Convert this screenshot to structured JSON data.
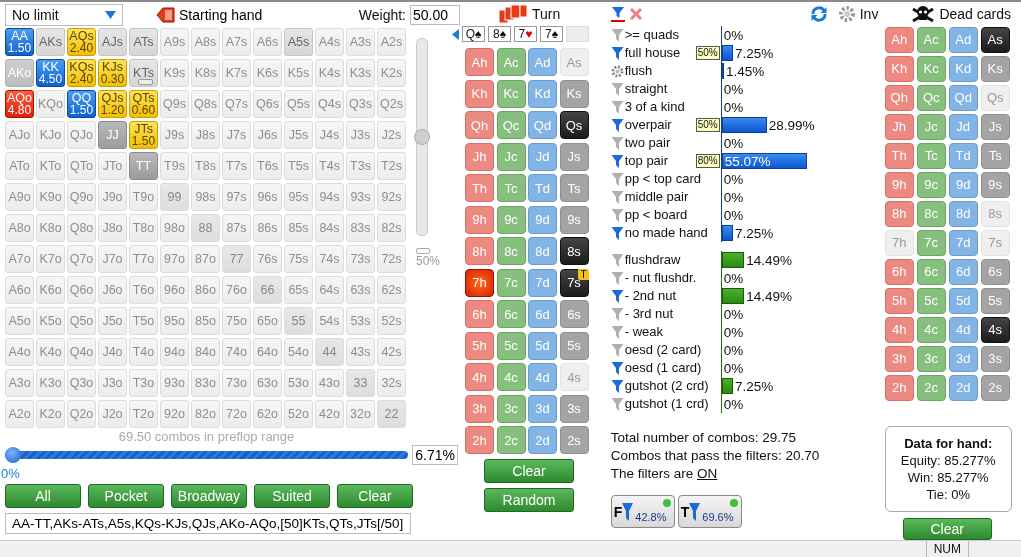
{
  "range_panel": {
    "game_type": "No limit",
    "starting_hand_label": "Starting hand",
    "weight_label": "Weight:",
    "weight_value": "50.00",
    "weight_slider": {
      "level": 0.5,
      "label": "50%"
    },
    "matrix": [
      [
        {
          "label": "AA",
          "kind": "blue",
          "weight": "1.50"
        },
        {
          "label": "AKs",
          "kind": "grey"
        },
        {
          "label": "AQs",
          "kind": "yellow",
          "weight": "2.40"
        },
        {
          "label": "AJs",
          "kind": "grey"
        },
        {
          "label": "ATs",
          "kind": "grey"
        },
        {
          "label": "A9s",
          "kind": "off"
        },
        {
          "label": "A8s",
          "kind": "off"
        },
        {
          "label": "A7s",
          "kind": "off"
        },
        {
          "label": "A6s",
          "kind": "off"
        },
        {
          "label": "A5s",
          "kind": "grey"
        },
        {
          "label": "A4s",
          "kind": "off"
        },
        {
          "label": "A3s",
          "kind": "off"
        },
        {
          "label": "A2s",
          "kind": "off"
        }
      ],
      [
        {
          "label": "AKo",
          "kind": "medium"
        },
        {
          "label": "KK",
          "kind": "blue",
          "weight": "4.50"
        },
        {
          "label": "KQs",
          "kind": "yellow",
          "weight": "2.40"
        },
        {
          "label": "KJs",
          "kind": "yellow",
          "weight": "0.30"
        },
        {
          "label": "KTs",
          "kind": "grey",
          "bar": true
        },
        {
          "label": "K9s",
          "kind": "off"
        },
        {
          "label": "K8s",
          "kind": "off"
        },
        {
          "label": "K7s",
          "kind": "off"
        },
        {
          "label": "K6s",
          "kind": "off"
        },
        {
          "label": "K5s",
          "kind": "off"
        },
        {
          "label": "K4s",
          "kind": "off"
        },
        {
          "label": "K3s",
          "kind": "off"
        },
        {
          "label": "K2s",
          "kind": "off"
        }
      ],
      [
        {
          "label": "AQo",
          "kind": "red",
          "weight": "4.80"
        },
        {
          "label": "KQo",
          "kind": "off"
        },
        {
          "label": "QQ",
          "kind": "blue",
          "weight": "1.50"
        },
        {
          "label": "QJs",
          "kind": "yellow",
          "weight": "1.20"
        },
        {
          "label": "QTs",
          "kind": "yellow",
          "weight": "0.60"
        },
        {
          "label": "Q9s",
          "kind": "off"
        },
        {
          "label": "Q8s",
          "kind": "off"
        },
        {
          "label": "Q7s",
          "kind": "off"
        },
        {
          "label": "Q6s",
          "kind": "off"
        },
        {
          "label": "Q5s",
          "kind": "off"
        },
        {
          "label": "Q4s",
          "kind": "off"
        },
        {
          "label": "Q3s",
          "kind": "off"
        },
        {
          "label": "Q2s",
          "kind": "off"
        }
      ],
      [
        {
          "label": "AJo",
          "kind": "off"
        },
        {
          "label": "KJo",
          "kind": "off"
        },
        {
          "label": "QJo",
          "kind": "off"
        },
        {
          "label": "JJ",
          "kind": "dark"
        },
        {
          "label": "JTs",
          "kind": "yellow",
          "weight": "1.50"
        },
        {
          "label": "J9s",
          "kind": "off"
        },
        {
          "label": "J8s",
          "kind": "off"
        },
        {
          "label": "J7s",
          "kind": "off"
        },
        {
          "label": "J6s",
          "kind": "off"
        },
        {
          "label": "J5s",
          "kind": "off"
        },
        {
          "label": "J4s",
          "kind": "off"
        },
        {
          "label": "J3s",
          "kind": "off"
        },
        {
          "label": "J2s",
          "kind": "off"
        }
      ],
      [
        {
          "label": "ATo",
          "kind": "off"
        },
        {
          "label": "KTo",
          "kind": "off"
        },
        {
          "label": "QTo",
          "kind": "off"
        },
        {
          "label": "JTo",
          "kind": "off"
        },
        {
          "label": "TT",
          "kind": "dark"
        },
        {
          "label": "T9s",
          "kind": "off"
        },
        {
          "label": "T8s",
          "kind": "off"
        },
        {
          "label": "T7s",
          "kind": "off"
        },
        {
          "label": "T6s",
          "kind": "off"
        },
        {
          "label": "T5s",
          "kind": "off"
        },
        {
          "label": "T4s",
          "kind": "off"
        },
        {
          "label": "T3s",
          "kind": "off"
        },
        {
          "label": "T2s",
          "kind": "off"
        }
      ],
      [
        {
          "label": "A9o",
          "kind": "off"
        },
        {
          "label": "K9o",
          "kind": "off"
        },
        {
          "label": "Q9o",
          "kind": "off"
        },
        {
          "label": "J9o",
          "kind": "off"
        },
        {
          "label": "T9o",
          "kind": "off"
        },
        {
          "label": "99",
          "kind": "pair"
        },
        {
          "label": "98s",
          "kind": "off"
        },
        {
          "label": "97s",
          "kind": "off"
        },
        {
          "label": "96s",
          "kind": "off"
        },
        {
          "label": "95s",
          "kind": "off"
        },
        {
          "label": "94s",
          "kind": "off"
        },
        {
          "label": "93s",
          "kind": "off"
        },
        {
          "label": "92s",
          "kind": "off"
        }
      ],
      [
        {
          "label": "A8o",
          "kind": "off"
        },
        {
          "label": "K8o",
          "kind": "off"
        },
        {
          "label": "Q8o",
          "kind": "off"
        },
        {
          "label": "J8o",
          "kind": "off"
        },
        {
          "label": "T8o",
          "kind": "off"
        },
        {
          "label": "98o",
          "kind": "off"
        },
        {
          "label": "88",
          "kind": "pair"
        },
        {
          "label": "87s",
          "kind": "off"
        },
        {
          "label": "86s",
          "kind": "off"
        },
        {
          "label": "85s",
          "kind": "off"
        },
        {
          "label": "84s",
          "kind": "off"
        },
        {
          "label": "83s",
          "kind": "off"
        },
        {
          "label": "82s",
          "kind": "off"
        }
      ],
      [
        {
          "label": "A7o",
          "kind": "off"
        },
        {
          "label": "K7o",
          "kind": "off"
        },
        {
          "label": "Q7o",
          "kind": "off"
        },
        {
          "label": "J7o",
          "kind": "off"
        },
        {
          "label": "T7o",
          "kind": "off"
        },
        {
          "label": "97o",
          "kind": "off"
        },
        {
          "label": "87o",
          "kind": "off"
        },
        {
          "label": "77",
          "kind": "pair"
        },
        {
          "label": "76s",
          "kind": "off"
        },
        {
          "label": "75s",
          "kind": "off"
        },
        {
          "label": "74s",
          "kind": "off"
        },
        {
          "label": "73s",
          "kind": "off"
        },
        {
          "label": "72s",
          "kind": "off"
        }
      ],
      [
        {
          "label": "A6o",
          "kind": "off"
        },
        {
          "label": "K6o",
          "kind": "off"
        },
        {
          "label": "Q6o",
          "kind": "off"
        },
        {
          "label": "J6o",
          "kind": "off"
        },
        {
          "label": "T6o",
          "kind": "off"
        },
        {
          "label": "96o",
          "kind": "off"
        },
        {
          "label": "86o",
          "kind": "off"
        },
        {
          "label": "76o",
          "kind": "off"
        },
        {
          "label": "66",
          "kind": "pair"
        },
        {
          "label": "65s",
          "kind": "off"
        },
        {
          "label": "64s",
          "kind": "off"
        },
        {
          "label": "63s",
          "kind": "off"
        },
        {
          "label": "62s",
          "kind": "off"
        }
      ],
      [
        {
          "label": "A5o",
          "kind": "off"
        },
        {
          "label": "K5o",
          "kind": "off"
        },
        {
          "label": "Q5o",
          "kind": "off"
        },
        {
          "label": "J5o",
          "kind": "off"
        },
        {
          "label": "T5o",
          "kind": "off"
        },
        {
          "label": "95o",
          "kind": "off"
        },
        {
          "label": "85o",
          "kind": "off"
        },
        {
          "label": "75o",
          "kind": "off"
        },
        {
          "label": "65o",
          "kind": "off"
        },
        {
          "label": "55",
          "kind": "pair"
        },
        {
          "label": "54s",
          "kind": "off"
        },
        {
          "label": "53s",
          "kind": "off"
        },
        {
          "label": "52s",
          "kind": "off"
        }
      ],
      [
        {
          "label": "A4o",
          "kind": "off"
        },
        {
          "label": "K4o",
          "kind": "off"
        },
        {
          "label": "Q4o",
          "kind": "off"
        },
        {
          "label": "J4o",
          "kind": "off"
        },
        {
          "label": "T4o",
          "kind": "off"
        },
        {
          "label": "94o",
          "kind": "off"
        },
        {
          "label": "84o",
          "kind": "off"
        },
        {
          "label": "74o",
          "kind": "off"
        },
        {
          "label": "64o",
          "kind": "off"
        },
        {
          "label": "54o",
          "kind": "off"
        },
        {
          "label": "44",
          "kind": "pair"
        },
        {
          "label": "43s",
          "kind": "off"
        },
        {
          "label": "42s",
          "kind": "off"
        }
      ],
      [
        {
          "label": "A3o",
          "kind": "off"
        },
        {
          "label": "K3o",
          "kind": "off"
        },
        {
          "label": "Q3o",
          "kind": "off"
        },
        {
          "label": "J3o",
          "kind": "off"
        },
        {
          "label": "T3o",
          "kind": "off"
        },
        {
          "label": "93o",
          "kind": "off"
        },
        {
          "label": "83o",
          "kind": "off"
        },
        {
          "label": "73o",
          "kind": "off"
        },
        {
          "label": "63o",
          "kind": "off"
        },
        {
          "label": "53o",
          "kind": "off"
        },
        {
          "label": "43o",
          "kind": "off"
        },
        {
          "label": "33",
          "kind": "pair"
        },
        {
          "label": "32s",
          "kind": "off"
        }
      ],
      [
        {
          "label": "A2o",
          "kind": "off"
        },
        {
          "label": "K2o",
          "kind": "off"
        },
        {
          "label": "Q2o",
          "kind": "off"
        },
        {
          "label": "J2o",
          "kind": "off"
        },
        {
          "label": "T2o",
          "kind": "off"
        },
        {
          "label": "92o",
          "kind": "off"
        },
        {
          "label": "82o",
          "kind": "off"
        },
        {
          "label": "72o",
          "kind": "off"
        },
        {
          "label": "62o",
          "kind": "off"
        },
        {
          "label": "52o",
          "kind": "off"
        },
        {
          "label": "42o",
          "kind": "off"
        },
        {
          "label": "32o",
          "kind": "off"
        },
        {
          "label": "22",
          "kind": "pair"
        }
      ]
    ],
    "combos_text": "69.50 combos in preflop range",
    "range_slider": {
      "level": 0,
      "label": "0%"
    },
    "percent_value": "6.71%",
    "buttons": [
      "All",
      "Pocket",
      "Broadway",
      "Suited",
      "Clear"
    ],
    "range_text": "AA-TT,AKs-ATs,A5s,KQs-KJs,QJs,AKo-AQo,[50]KTs,QTs,JTs[/50]"
  },
  "board_panel": {
    "street": "Turn",
    "board": [
      {
        "rank": "Q",
        "suit": "♠",
        "color": "#000000"
      },
      {
        "rank": "8",
        "suit": "♠",
        "color": "#000000"
      },
      {
        "rank": "7",
        "suit": "♥",
        "color": "#e00000"
      },
      {
        "rank": "7",
        "suit": "♠",
        "color": "#000000"
      }
    ],
    "cards": [
      [
        {
          "label": "Ah",
          "kind": "open"
        },
        {
          "label": "Ac",
          "kind": "open"
        },
        {
          "label": "Ad",
          "kind": "open"
        },
        {
          "label": "As",
          "kind": "blocked"
        }
      ],
      [
        {
          "label": "Kh",
          "kind": "open"
        },
        {
          "label": "Kc",
          "kind": "open"
        },
        {
          "label": "Kd",
          "kind": "open"
        },
        {
          "label": "Ks",
          "kind": "open"
        }
      ],
      [
        {
          "label": "Qh",
          "kind": "open"
        },
        {
          "label": "Qc",
          "kind": "open"
        },
        {
          "label": "Qd",
          "kind": "open"
        },
        {
          "label": "Qs",
          "kind": "board"
        }
      ],
      [
        {
          "label": "Jh",
          "kind": "open"
        },
        {
          "label": "Jc",
          "kind": "open"
        },
        {
          "label": "Jd",
          "kind": "open"
        },
        {
          "label": "Js",
          "kind": "open"
        }
      ],
      [
        {
          "label": "Th",
          "kind": "open"
        },
        {
          "label": "Tc",
          "kind": "open"
        },
        {
          "label": "Td",
          "kind": "open"
        },
        {
          "label": "Ts",
          "kind": "open"
        }
      ],
      [
        {
          "label": "9h",
          "kind": "open"
        },
        {
          "label": "9c",
          "kind": "open"
        },
        {
          "label": "9d",
          "kind": "open"
        },
        {
          "label": "9s",
          "kind": "open"
        }
      ],
      [
        {
          "label": "8h",
          "kind": "open"
        },
        {
          "label": "8c",
          "kind": "open"
        },
        {
          "label": "8d",
          "kind": "open"
        },
        {
          "label": "8s",
          "kind": "board"
        }
      ],
      [
        {
          "label": "7h",
          "kind": "hero"
        },
        {
          "label": "7c",
          "kind": "open"
        },
        {
          "label": "7d",
          "kind": "open"
        },
        {
          "label": "7s",
          "kind": "board",
          "badge": "T"
        }
      ],
      [
        {
          "label": "6h",
          "kind": "open"
        },
        {
          "label": "6c",
          "kind": "open"
        },
        {
          "label": "6d",
          "kind": "open"
        },
        {
          "label": "6s",
          "kind": "open"
        }
      ],
      [
        {
          "label": "5h",
          "kind": "open"
        },
        {
          "label": "5c",
          "kind": "open"
        },
        {
          "label": "5d",
          "kind": "open"
        },
        {
          "label": "5s",
          "kind": "open"
        }
      ],
      [
        {
          "label": "4h",
          "kind": "open"
        },
        {
          "label": "4c",
          "kind": "open"
        },
        {
          "label": "4d",
          "kind": "open"
        },
        {
          "label": "4s",
          "kind": "blocked"
        }
      ],
      [
        {
          "label": "3h",
          "kind": "open"
        },
        {
          "label": "3c",
          "kind": "open"
        },
        {
          "label": "3d",
          "kind": "open"
        },
        {
          "label": "3s",
          "kind": "open"
        }
      ],
      [
        {
          "label": "2h",
          "kind": "open"
        },
        {
          "label": "2c",
          "kind": "open"
        },
        {
          "label": "2d",
          "kind": "open"
        },
        {
          "label": "2s",
          "kind": "open"
        }
      ]
    ],
    "buttons": [
      "Clear",
      "Random"
    ]
  },
  "stats": {
    "made": [
      {
        "label": ">= quads",
        "kind": "filter",
        "on": false,
        "reading": "0%"
      },
      {
        "label": "full house",
        "kind": "filter",
        "on": true,
        "badge": "50%",
        "level": 0.0725,
        "reading": "7.25%"
      },
      {
        "label": "flush",
        "kind": "gear",
        "level": 0.0145,
        "reading": "1.45%"
      },
      {
        "label": "straight",
        "kind": "filter",
        "on": false,
        "reading": "0%"
      },
      {
        "label": "3 of a kind",
        "kind": "filter",
        "on": false,
        "reading": "0%"
      },
      {
        "label": "overpair",
        "kind": "filter",
        "on": true,
        "badge": "50%",
        "level": 0.2899,
        "reading": "28.99%"
      },
      {
        "label": "two pair",
        "kind": "filter",
        "on": false,
        "reading": "0%"
      },
      {
        "label": "top pair",
        "kind": "filter",
        "on": true,
        "badge": "80%",
        "level": 0.5507,
        "reading": "55.07%"
      },
      {
        "label": "pp < top card",
        "kind": "filter",
        "on": false,
        "reading": "0%"
      },
      {
        "label": "middle pair",
        "kind": "filter",
        "on": false,
        "reading": "0%"
      },
      {
        "label": "pp < board",
        "kind": "filter",
        "on": false,
        "reading": "0%"
      },
      {
        "label": "no made hand",
        "kind": "filter",
        "on": true,
        "level": 0.0725,
        "reading": "7.25%"
      }
    ],
    "draws": [
      {
        "label": "flushdraw",
        "kind": "filter",
        "on": false,
        "level": 0.1449,
        "reading": "14.49%"
      },
      {
        "label": "- nut flushdr.",
        "kind": "filter",
        "on": false,
        "reading": "0%"
      },
      {
        "label": "- 2nd nut",
        "kind": "filter",
        "on": true,
        "level": 0.1449,
        "reading": "14.49%"
      },
      {
        "label": "- 3rd nut",
        "kind": "filter",
        "on": false,
        "reading": "0%"
      },
      {
        "label": "- weak",
        "kind": "filter",
        "on": false,
        "reading": "0%"
      },
      {
        "label": "oesd (2 card)",
        "kind": "filter",
        "on": false,
        "reading": "0%"
      },
      {
        "label": "oesd (1 card)",
        "kind": "filter",
        "on": true,
        "reading": "0%"
      },
      {
        "label": "gutshot (2 crd)",
        "kind": "filter",
        "on": true,
        "level": 0.0725,
        "reading": "7.25%"
      },
      {
        "label": "gutshot (1 crd)",
        "kind": "filter",
        "on": false,
        "reading": "0%"
      }
    ],
    "total_combos": "Total number of combos: 29.75",
    "passing_combos": "Combos that pass the filters: 20.70",
    "filters_status": {
      "text": "The filters are",
      "link": "ON"
    },
    "filter_buttons": [
      {
        "letter": "F",
        "value": "42.8%"
      },
      {
        "letter": "T",
        "value": "69.6%"
      }
    ]
  },
  "dead_panel": {
    "inv_label": "Inv",
    "title": "Dead cards",
    "cards": [
      [
        {
          "label": "Ah",
          "kind": "open"
        },
        {
          "label": "Ac",
          "kind": "open"
        },
        {
          "label": "Ad",
          "kind": "open"
        },
        {
          "label": "As",
          "kind": "dead"
        }
      ],
      [
        {
          "label": "Kh",
          "kind": "open"
        },
        {
          "label": "Kc",
          "kind": "open"
        },
        {
          "label": "Kd",
          "kind": "open"
        },
        {
          "label": "Ks",
          "kind": "open"
        }
      ],
      [
        {
          "label": "Qh",
          "kind": "open"
        },
        {
          "label": "Qc",
          "kind": "open"
        },
        {
          "label": "Qd",
          "kind": "open"
        },
        {
          "label": "Qs",
          "kind": "blocked"
        }
      ],
      [
        {
          "label": "Jh",
          "kind": "open"
        },
        {
          "label": "Jc",
          "kind": "open"
        },
        {
          "label": "Jd",
          "kind": "open"
        },
        {
          "label": "Js",
          "kind": "open"
        }
      ],
      [
        {
          "label": "Th",
          "kind": "open"
        },
        {
          "label": "Tc",
          "kind": "open"
        },
        {
          "label": "Td",
          "kind": "open"
        },
        {
          "label": "Ts",
          "kind": "open"
        }
      ],
      [
        {
          "label": "9h",
          "kind": "open"
        },
        {
          "label": "9c",
          "kind": "open"
        },
        {
          "label": "9d",
          "kind": "open"
        },
        {
          "label": "9s",
          "kind": "open"
        }
      ],
      [
        {
          "label": "8h",
          "kind": "open"
        },
        {
          "label": "8c",
          "kind": "open"
        },
        {
          "label": "8d",
          "kind": "open"
        },
        {
          "label": "8s",
          "kind": "blocked"
        }
      ],
      [
        {
          "label": "7h",
          "kind": "blocked"
        },
        {
          "label": "7c",
          "kind": "open"
        },
        {
          "label": "7d",
          "kind": "open"
        },
        {
          "label": "7s",
          "kind": "blocked"
        }
      ],
      [
        {
          "label": "6h",
          "kind": "open"
        },
        {
          "label": "6c",
          "kind": "open"
        },
        {
          "label": "6d",
          "kind": "open"
        },
        {
          "label": "6s",
          "kind": "open"
        }
      ],
      [
        {
          "label": "5h",
          "kind": "open"
        },
        {
          "label": "5c",
          "kind": "open"
        },
        {
          "label": "5d",
          "kind": "open"
        },
        {
          "label": "5s",
          "kind": "open"
        }
      ],
      [
        {
          "label": "4h",
          "kind": "open"
        },
        {
          "label": "4c",
          "kind": "open"
        },
        {
          "label": "4d",
          "kind": "open"
        },
        {
          "label": "4s",
          "kind": "dead"
        }
      ],
      [
        {
          "label": "3h",
          "kind": "open"
        },
        {
          "label": "3c",
          "kind": "open"
        },
        {
          "label": "3d",
          "kind": "open"
        },
        {
          "label": "3s",
          "kind": "open"
        }
      ],
      [
        {
          "label": "2h",
          "kind": "open"
        },
        {
          "label": "2c",
          "kind": "open"
        },
        {
          "label": "2d",
          "kind": "open"
        },
        {
          "label": "2s",
          "kind": "open"
        }
      ]
    ],
    "data_title": "Data for hand:",
    "data_lines": [
      "Equity: 85.277%",
      "Win: 85.277%",
      "Tie: 0%"
    ],
    "clear_button": "Clear"
  },
  "status_bar": {
    "indicator": "NUM"
  }
}
